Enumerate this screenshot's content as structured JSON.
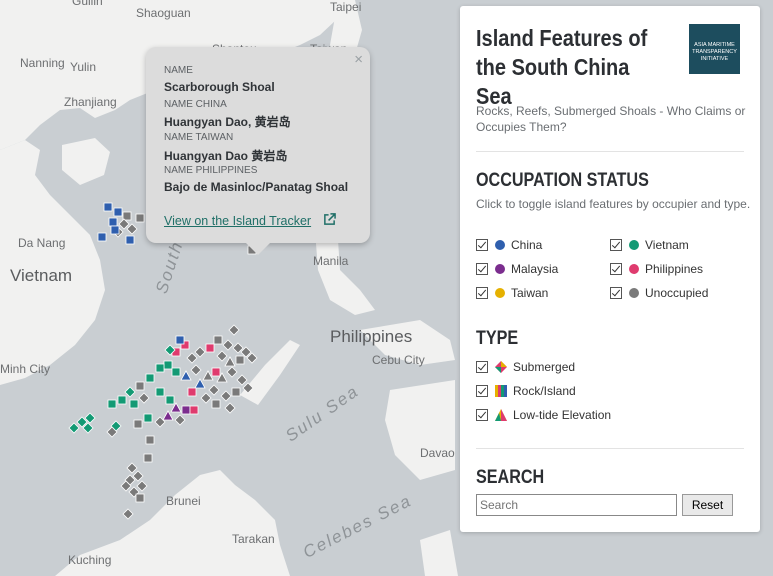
{
  "colors": {
    "water": "#c9ced2",
    "land": "#f1f1f0",
    "china": "#2f5fae",
    "vietnam": "#139a74",
    "malaysia": "#7b2d8e",
    "philippines": "#df3b6e",
    "taiwan": "#e6b100",
    "unoccupied": "#7a7a7a"
  },
  "map": {
    "places": [
      "Guilin",
      "Shaoguan",
      "Taipei",
      "Shantou",
      "Taiwan",
      "Nanning",
      "Yulin",
      "Zhanjiang",
      "Da Nang",
      "Manila",
      "Cebu City",
      "Minh City",
      "Davao",
      "Brunei",
      "Tarakan",
      "Kuching"
    ],
    "countries": [
      "Vietnam",
      "Philippines"
    ],
    "seas": [
      "South China",
      "Sulu Sea",
      "Celebes Sea"
    ]
  },
  "popup": {
    "close": "×",
    "label_name": "NAME",
    "name": "Scarborough Shoal",
    "label_china": "NAME CHINA",
    "name_china": "Huangyan Dao, 黄岩岛",
    "label_taiwan": "NAME TAIWAN",
    "name_taiwan": "Huangyan Dao 黄岩岛",
    "label_philippines": "NAME PHILIPPINES",
    "name_philippines": "Bajo de Masinloc/Panatag Shoal",
    "link": "View on the Island Tracker",
    "link_icon": "external-link-icon"
  },
  "panel": {
    "title": "Island Features of the South China Sea",
    "logo_text": "ASIA MARITIME TRANSPARENCY INITIATIVE",
    "subtitle": "Rocks, Reefs, Submerged Shoals - Who Claims or Occupies Them?",
    "occupation_heading": "OCCUPATION STATUS",
    "occupation_desc": "Click to toggle island features by occupier and type.",
    "occupiers": [
      {
        "label": "China",
        "checked": true
      },
      {
        "label": "Vietnam",
        "checked": true
      },
      {
        "label": "Malaysia",
        "checked": true
      },
      {
        "label": "Philippines",
        "checked": true
      },
      {
        "label": "Taiwan",
        "checked": true
      },
      {
        "label": "Unoccupied",
        "checked": true
      }
    ],
    "type_heading": "TYPE",
    "types": [
      {
        "label": "Submerged",
        "icon": "diamond-icon",
        "checked": true
      },
      {
        "label": "Rock/Island",
        "icon": "square-icon",
        "checked": true
      },
      {
        "label": "Low-tide Elevation",
        "icon": "triangle-icon",
        "checked": true
      }
    ],
    "search_heading": "SEARCH",
    "search_placeholder": "Search",
    "reset_label": "Reset"
  }
}
